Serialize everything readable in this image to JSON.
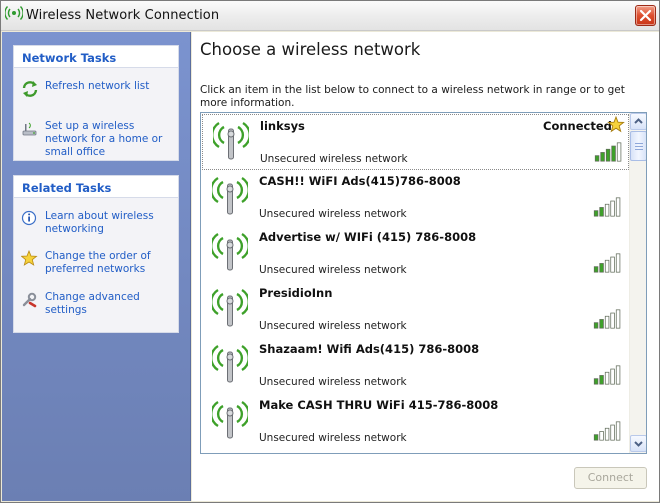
{
  "window": {
    "title": "Wireless Network Connection",
    "title_icon": "wireless-icon",
    "close_icon": "close-icon"
  },
  "network_tasks": {
    "header": "Network Tasks",
    "items": [
      {
        "label": "Refresh network list",
        "icon": "refresh-icon"
      },
      {
        "label": "Set up a wireless network for a home or small office",
        "icon": "wireless-setup-icon"
      }
    ]
  },
  "related_tasks": {
    "header": "Related Tasks",
    "items": [
      {
        "label": "Learn about wireless networking",
        "icon": "info-icon"
      },
      {
        "label": "Change the order of preferred networks",
        "icon": "star-icon"
      },
      {
        "label": "Change advanced settings",
        "icon": "settings-tools-icon"
      }
    ]
  },
  "main": {
    "heading": "Choose a wireless network",
    "intro": "Click an item in the list below to connect to a wireless network in range or to get more information.",
    "networks": [
      {
        "name": "linksys",
        "security": "Unsecured wireless network",
        "status": "Connected",
        "signal_bars": 4,
        "selected": true
      },
      {
        "name": "CASH!! WiFI Ads(415)786-8008",
        "security": "Unsecured wireless network",
        "signal_bars": 2
      },
      {
        "name": "Advertise w/ WIFi (415) 786-8008",
        "security": "Unsecured wireless network",
        "signal_bars": 2
      },
      {
        "name": "PresidioInn",
        "security": "Unsecured wireless network",
        "signal_bars": 2
      },
      {
        "name": "Shazaam! Wifi Ads(415) 786-8008",
        "security": "Unsecured wireless network",
        "signal_bars": 2
      },
      {
        "name": "Make CASH THRU WiFi 415-786-8008",
        "security": "Unsecured wireless network",
        "signal_bars": 1
      }
    ],
    "connect_label": "Connect"
  },
  "colors": {
    "signal_on": "#3ea12a",
    "signal_off": "#ffffff",
    "link": "#215dc6",
    "sidebar": "#7b93cf"
  }
}
